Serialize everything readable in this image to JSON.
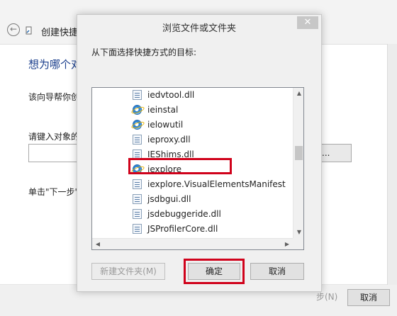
{
  "background_window": {
    "back_glyph": "←",
    "title": "创建快捷",
    "heading": "想为哪个对",
    "description": "该向导帮你创",
    "input_label": "请键入对象的",
    "browse_label": "R)...",
    "next_hint": "单击\"下一步\"",
    "next_button": "步(N)",
    "cancel_button": "取消"
  },
  "dialog": {
    "title": "浏览文件或文件夹",
    "close_glyph": "✕",
    "prompt": "从下面选择快捷方式的目标:",
    "items": [
      {
        "label": "iedvtool.dll",
        "icon": "file-icon"
      },
      {
        "label": "ieinstal",
        "icon": "ie-icon"
      },
      {
        "label": "ielowutil",
        "icon": "ie-icon"
      },
      {
        "label": "ieproxy.dll",
        "icon": "file-icon"
      },
      {
        "label": "IEShims.dll",
        "icon": "file-icon"
      },
      {
        "label": "iexplore",
        "icon": "ie-icon"
      },
      {
        "label": "iexplore.VisualElementsManifest",
        "icon": "file-icon"
      },
      {
        "label": "jsdbgui.dll",
        "icon": "file-icon"
      },
      {
        "label": "jsdebuggeride.dll",
        "icon": "file-icon"
      },
      {
        "label": "JSProfilerCore.dll",
        "icon": "file-icon"
      }
    ],
    "new_folder_button": "新建文件夹(M)",
    "ok_button": "确定",
    "cancel_button": "取消",
    "highlight_color": "#d0021b"
  }
}
